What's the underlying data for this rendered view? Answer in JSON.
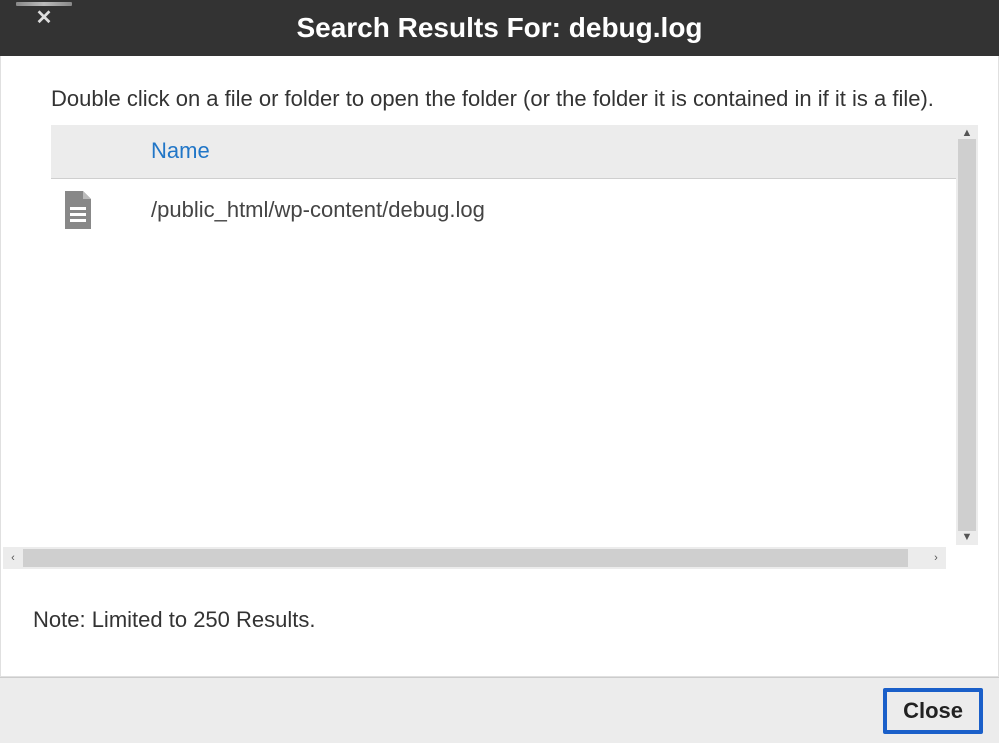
{
  "titlebar": {
    "title": "Search Results For: debug.log"
  },
  "instructions": "Double click on a file or folder to open the folder (or the folder it is contained in if it is a file).",
  "table": {
    "header": {
      "name": "Name"
    },
    "rows": [
      {
        "path": "/public_html/wp-content/debug.log"
      }
    ]
  },
  "note": "Note: Limited to 250 Results.",
  "footer": {
    "close_label": "Close"
  }
}
